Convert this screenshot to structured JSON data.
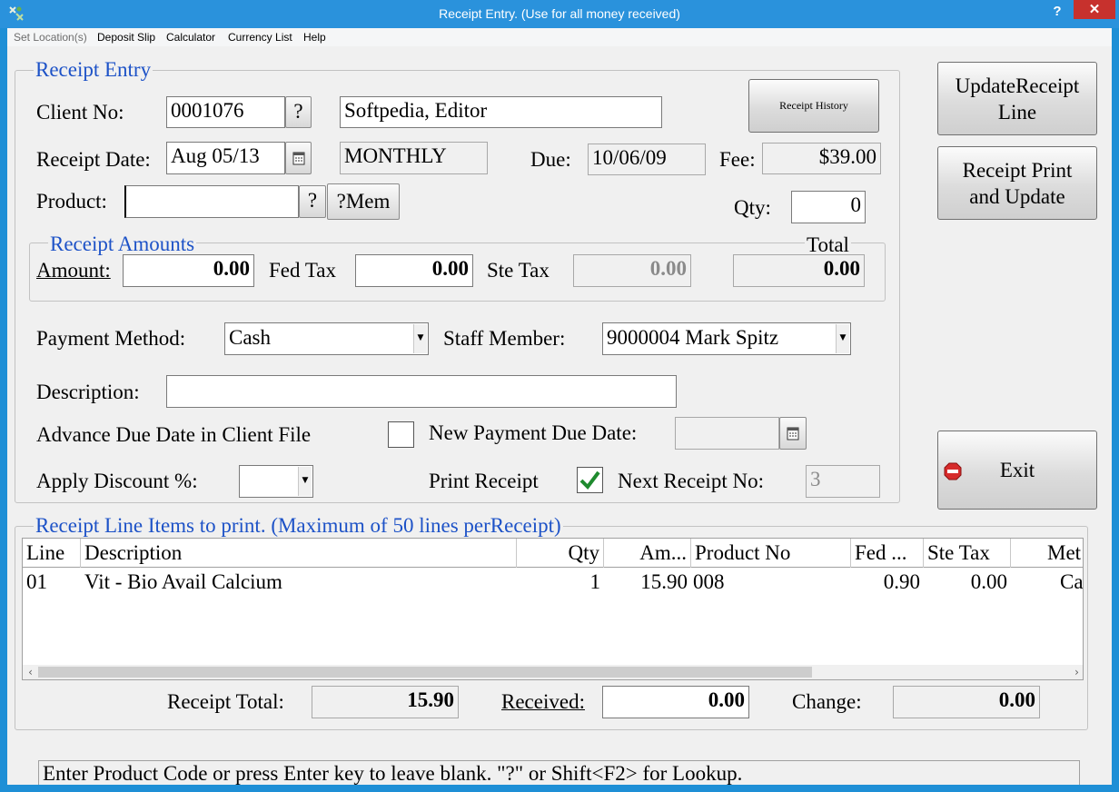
{
  "window": {
    "title": "Receipt Entry. (Use for all money received)",
    "help_label": "?",
    "close_label": "✕"
  },
  "menu": {
    "items": [
      "Set Location(s)",
      "Deposit Slip",
      "Calculator",
      "Currency List",
      "Help"
    ]
  },
  "receipt_entry": {
    "group_title": "Receipt Entry",
    "client_no_label": "Client No:",
    "client_no": "0001076",
    "lookup_label": "?",
    "client_name": "Softpedia, Editor",
    "receipt_history_label": "Receipt History",
    "receipt_date_label": "Receipt Date:",
    "receipt_date": "Aug 05/13",
    "plan": "MONTHLY",
    "due_label": "Due:",
    "due_date": "10/06/09",
    "fee_label": "Fee:",
    "fee": "$39.00",
    "product_label": "Product:",
    "product": "",
    "product_lookup_label": "?",
    "mem_label": "?Mem",
    "qty_label": "Qty:",
    "qty": "0"
  },
  "amounts": {
    "group_title": "Receipt Amounts",
    "amount_label": "Amount:",
    "amount": "0.00",
    "fed_tax_label": "Fed Tax",
    "fed_tax": "0.00",
    "ste_tax_label": "Ste Tax",
    "ste_tax": "0.00",
    "total_label": "Total",
    "total": "0.00"
  },
  "payment": {
    "method_label": "Payment Method:",
    "method": "Cash",
    "staff_label": "Staff Member:",
    "staff": "9000004 Mark Spitz",
    "description_label": "Description:",
    "description": "",
    "advance_label": "Advance Due Date in Client File",
    "advance_checked": false,
    "new_due_label": "New Payment Due Date:",
    "new_due": "",
    "discount_label": "Apply Discount %:",
    "discount": "",
    "print_receipt_label": "Print Receipt",
    "print_receipt_checked": true,
    "next_receipt_label": "Next Receipt No:",
    "next_receipt": "3"
  },
  "side_buttons": {
    "update_line_1": "UpdateReceipt",
    "update_line_2": "Line",
    "print_line_1": "Receipt Print",
    "print_line_2": "and Update",
    "exit_label": "Exit"
  },
  "line_items": {
    "group_title": "Receipt Line Items to print. (Maximum of 50 lines perReceipt)",
    "columns": [
      "Line",
      "Description",
      "Qty",
      "Am...",
      "Product No",
      "Fed ...",
      "Ste Tax",
      "Met"
    ],
    "rows": [
      {
        "line": "01",
        "description": "Vit - Bio Avail Calcium",
        "qty": "1",
        "amount": "15.90",
        "product_no": "008",
        "fed": "0.90",
        "ste": "0.00",
        "met": "Ca"
      }
    ]
  },
  "totals": {
    "receipt_total_label": "Receipt Total:",
    "receipt_total": "15.90",
    "received_label": "Received:",
    "received": "0.00",
    "change_label": "Change:",
    "change": "0.00"
  },
  "status": {
    "message": "Enter Product Code or press Enter key to leave blank. \"?\" or Shift<F2> for Lookup."
  },
  "colors": {
    "titlebar": "#2a92dc",
    "group_title": "#1d52c7",
    "close": "#c7312d",
    "check": "#1e8a2e"
  }
}
